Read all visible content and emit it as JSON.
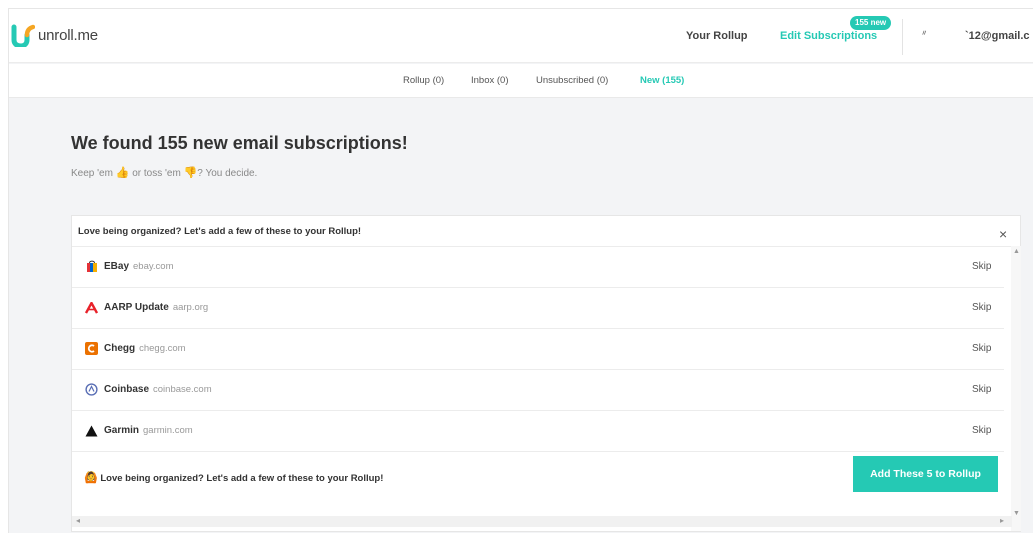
{
  "brand": {
    "name": "unroll.me",
    "accent": "#25c9b4"
  },
  "nav": {
    "your_rollup": "Your Rollup",
    "edit_subscriptions": "Edit Subscriptions",
    "new_badge": "155 new",
    "user_glyph": "ᐥ",
    "user_email": "`12@gmail.c"
  },
  "tabs": {
    "rollup": "Rollup (0)",
    "inbox": "Inbox (0)",
    "unsubscribed": "Unsubscribed (0)",
    "new": "New (155)"
  },
  "main": {
    "headline": "We found 155 new email subscriptions!",
    "sub_prefix": "Keep 'em ",
    "sub_middle": " or toss 'em ",
    "sub_suffix": "? You decide.",
    "thumbs_up": "👍",
    "thumbs_down": "👎"
  },
  "panel": {
    "title": "Love being organized? Let's add a few of these to your Rollup!",
    "close": "×",
    "rows": [
      {
        "name": "EBay",
        "domain": "ebay.com",
        "skip": "Skip",
        "icon": "bag-icon"
      },
      {
        "name": "AARP Update",
        "domain": "aarp.org",
        "skip": "Skip",
        "icon": "aarp-icon"
      },
      {
        "name": "Chegg",
        "domain": "chegg.com",
        "skip": "Skip",
        "icon": "chegg-icon"
      },
      {
        "name": "Coinbase",
        "domain": "coinbase.com",
        "skip": "Skip",
        "icon": "circle-icon"
      },
      {
        "name": "Garmin",
        "domain": "garmin.com",
        "skip": "Skip",
        "icon": "triangle-icon"
      }
    ],
    "footer_text": "Love being organized? Let's add a few of these to your Rollup!",
    "add_button": "Add These 5 to Rollup"
  }
}
